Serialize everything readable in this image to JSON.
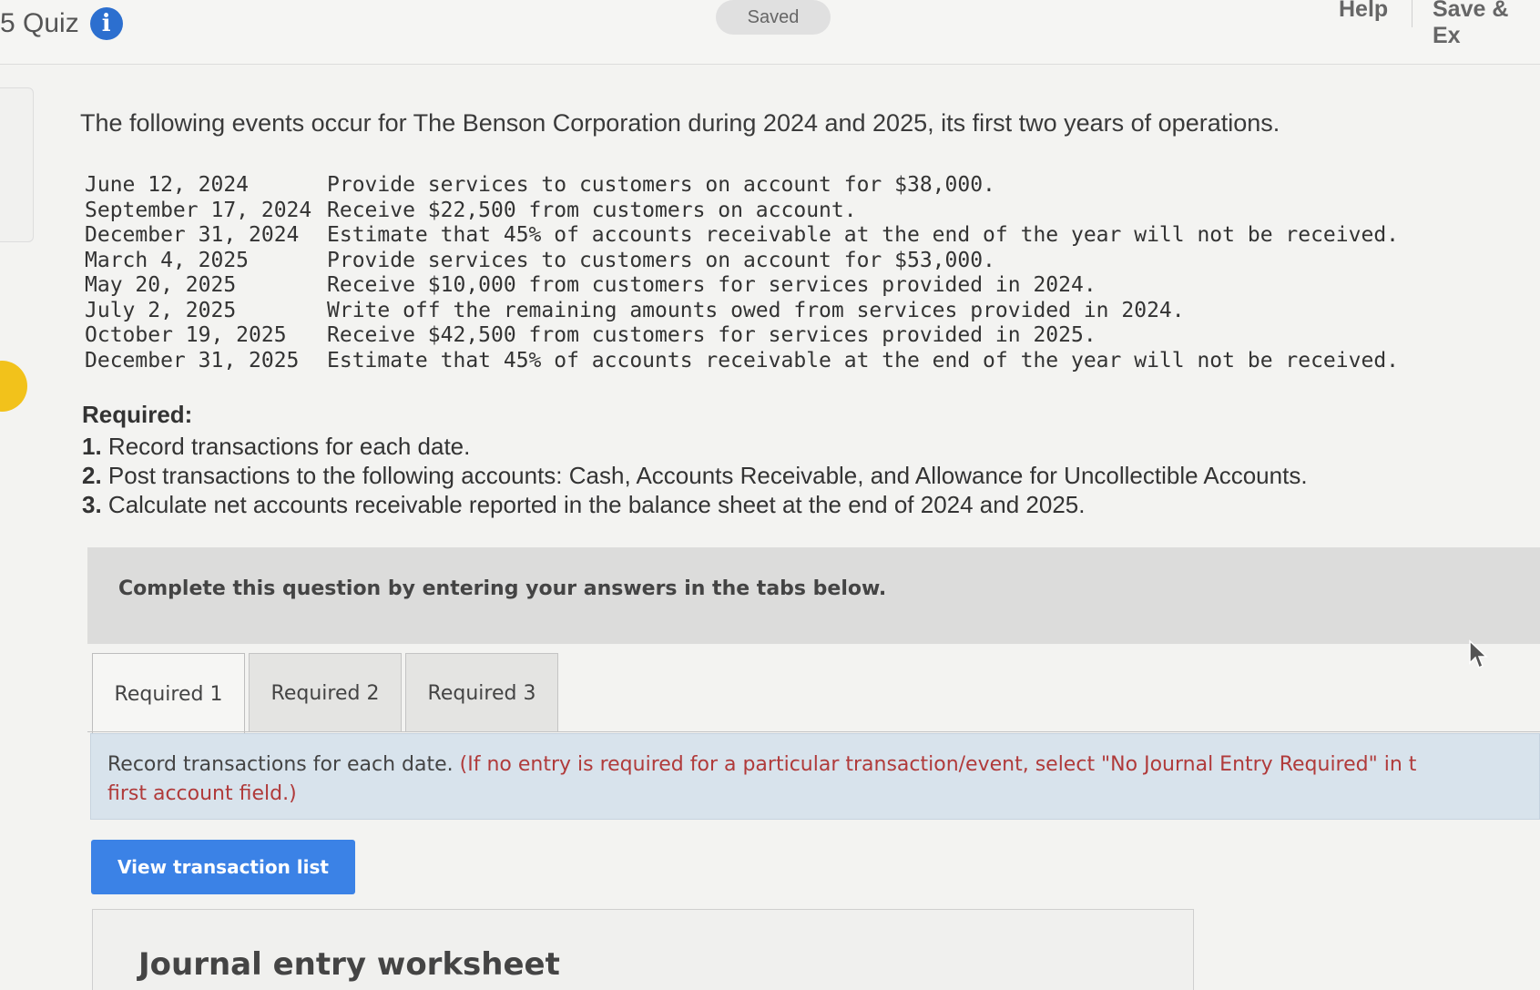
{
  "header": {
    "quiz_label": "5 Quiz",
    "info_icon": "info-icon",
    "saved_status": "Saved",
    "help_label": "Help",
    "save_exit_label": "Save & Ex"
  },
  "question": {
    "intro": "The following events occur for The Benson Corporation during 2024 and 2025, its first two years of operations.",
    "events": [
      {
        "date": "June 12, 2024",
        "text": "Provide services to customers on account for $38,000."
      },
      {
        "date": "September 17, 2024",
        "text": "Receive $22,500 from customers on account."
      },
      {
        "date": "December 31, 2024",
        "text": "Estimate that 45% of accounts receivable at the end of the year will not be received."
      },
      {
        "date": "March 4, 2025",
        "text": "Provide services to customers on account for $53,000."
      },
      {
        "date": "May 20, 2025",
        "text": "Receive $10,000 from customers for services provided in 2024."
      },
      {
        "date": "July 2, 2025",
        "text": "Write off the remaining amounts owed from services provided in 2024."
      },
      {
        "date": "October 19, 2025",
        "text": "Receive $42,500 from customers for services provided in 2025."
      },
      {
        "date": "December 31, 2025",
        "text": "Estimate that 45% of accounts receivable at the end of the year will not be received."
      }
    ],
    "required_heading": "Required:",
    "required_items": [
      {
        "num": "1.",
        "text": "Record transactions for each date."
      },
      {
        "num": "2.",
        "text": "Post transactions to the following accounts: Cash, Accounts Receivable, and Allowance for Uncollectible Accounts."
      },
      {
        "num": "3.",
        "text": "Calculate net accounts receivable reported in the balance sheet at the end of 2024 and 2025."
      }
    ]
  },
  "answer_area": {
    "complete_banner": "Complete this question by entering your answers in the tabs below.",
    "tabs": [
      {
        "label": "Required 1",
        "active": true
      },
      {
        "label": "Required 2",
        "active": false
      },
      {
        "label": "Required 3",
        "active": false
      }
    ],
    "instruction_main": "Record transactions for each date.",
    "instruction_note_line1": "(If no entry is required for a particular transaction/event, select \"No Journal Entry Required\" in t",
    "instruction_note_line2": "first account field.)",
    "view_button": "View transaction list",
    "worksheet_title": "Journal entry worksheet"
  },
  "colors": {
    "accent": "#3b82e6",
    "info": "#2c6fcf",
    "note": "#b03a3a",
    "indicator": "#f2c21b"
  }
}
